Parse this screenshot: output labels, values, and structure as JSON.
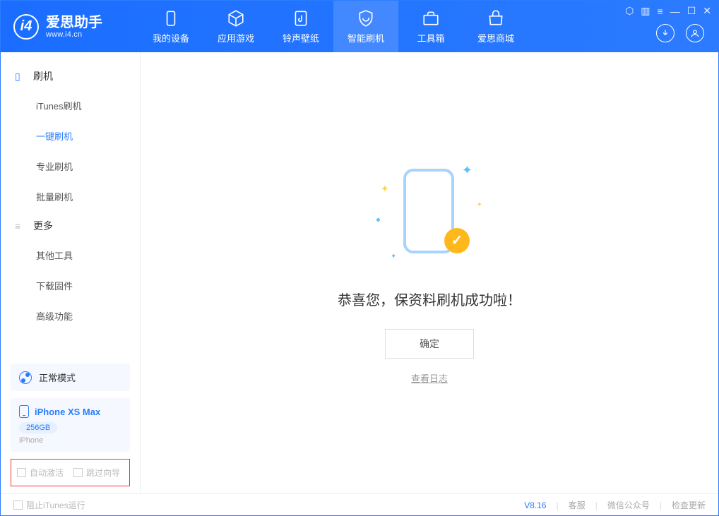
{
  "app": {
    "name": "爱思助手",
    "url": "www.i4.cn"
  },
  "header": {
    "tabs": [
      {
        "label": "我的设备",
        "icon": "device-icon"
      },
      {
        "label": "应用游戏",
        "icon": "cube-icon"
      },
      {
        "label": "铃声壁纸",
        "icon": "music-file-icon"
      },
      {
        "label": "智能刷机",
        "icon": "shield-refresh-icon",
        "active": true
      },
      {
        "label": "工具箱",
        "icon": "toolbox-icon"
      },
      {
        "label": "爱思商城",
        "icon": "shop-icon"
      }
    ]
  },
  "sidebar": {
    "sections": [
      {
        "title": "刷机",
        "icon": "phone-icon",
        "items": [
          "iTunes刷机",
          "一键刷机",
          "专业刷机",
          "批量刷机"
        ],
        "activeIndex": 1
      },
      {
        "title": "更多",
        "icon": "menu-icon",
        "items": [
          "其他工具",
          "下载固件",
          "高级功能"
        ]
      }
    ],
    "mode": "正常模式",
    "device": {
      "name": "iPhone XS Max",
      "capacity": "256GB",
      "type": "iPhone"
    },
    "checkboxes": {
      "auto_activate": "自动激活",
      "skip_wizard": "跳过向导"
    }
  },
  "main": {
    "success_message": "恭喜您，保资料刷机成功啦！",
    "ok_button": "确定",
    "view_log": "查看日志"
  },
  "footer": {
    "block_itunes": "阻止iTunes运行",
    "version": "V8.16",
    "links": [
      "客服",
      "微信公众号",
      "检查更新"
    ]
  }
}
